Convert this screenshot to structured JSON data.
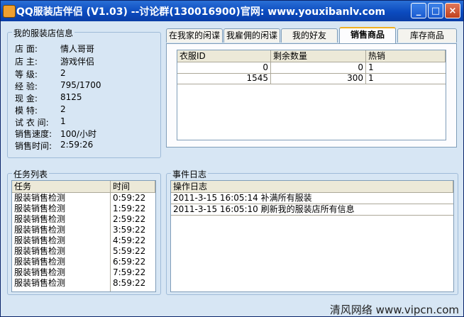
{
  "window": {
    "title": "QQ服装店伴侣 (V1.03) --讨论群(130016900)官网: www.youxibanlv.com",
    "min_label": "_",
    "max_label": "□",
    "close_label": "×"
  },
  "shop_info": {
    "legend": "我的服装店信息",
    "rows": [
      {
        "key": "店   面:",
        "value": "情人哥哥"
      },
      {
        "key": "店   主:",
        "value": "游戏伴侣"
      },
      {
        "key": "等   级:",
        "value": "2"
      },
      {
        "key": "经   验:",
        "value": "795/1700"
      },
      {
        "key": "现   金:",
        "value": "8125"
      },
      {
        "key": "模   特:",
        "value": "2"
      },
      {
        "key": "试 衣 间:",
        "value": "1"
      },
      {
        "key": "销售速度:",
        "value": "100/小时"
      },
      {
        "key": "销售时间:",
        "value": "2:59:26"
      }
    ]
  },
  "tabs": [
    {
      "label": "在我家的闲谍"
    },
    {
      "label": "我雇佣的闲谍"
    },
    {
      "label": "我的好友"
    },
    {
      "label": "销售商品"
    },
    {
      "label": "库存商品"
    }
  ],
  "sales_table": {
    "headers": [
      "衣服ID",
      "剩余数量",
      "热销"
    ],
    "rows": [
      [
        "0",
        "0",
        "1"
      ],
      [
        "1545",
        "300",
        "1"
      ]
    ]
  },
  "task_list": {
    "legend": "任务列表",
    "headers": [
      "任务",
      "时间"
    ],
    "rows": [
      [
        "服装销售检测",
        "0:59:22"
      ],
      [
        "服装销售检测",
        "1:59:22"
      ],
      [
        "服装销售检测",
        "2:59:22"
      ],
      [
        "服装销售检测",
        "3:59:22"
      ],
      [
        "服装销售检测",
        "4:59:22"
      ],
      [
        "服装销售检测",
        "5:59:22"
      ],
      [
        "服装销售检测",
        "6:59:22"
      ],
      [
        "服装销售检测",
        "7:59:22"
      ],
      [
        "服装销售检测",
        "8:59:22"
      ]
    ]
  },
  "event_log": {
    "legend": "事件日志",
    "header": "操作日志",
    "rows": [
      "2011-3-15 16:05:14  补满所有服装",
      "2011-3-15 16:05:10  刷新我的服装店所有信息"
    ]
  },
  "statusbar": {
    "watermark": "清风网络 www.vipcn.com"
  }
}
